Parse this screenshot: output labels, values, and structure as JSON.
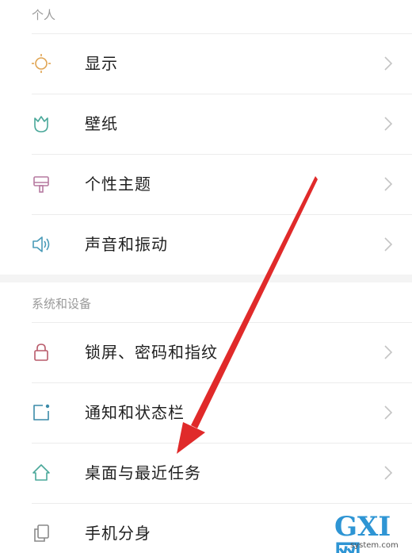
{
  "sections": {
    "personal": {
      "header": "个人",
      "items": [
        {
          "label": "显示",
          "icon": "sun-icon"
        },
        {
          "label": "壁纸",
          "icon": "flower-icon"
        },
        {
          "label": "个性主题",
          "icon": "brush-icon"
        },
        {
          "label": "声音和振动",
          "icon": "speaker-icon"
        }
      ]
    },
    "system": {
      "header": "系统和设备",
      "items": [
        {
          "label": "锁屏、密码和指纹",
          "icon": "lock-icon"
        },
        {
          "label": "通知和状态栏",
          "icon": "notification-icon"
        },
        {
          "label": "桌面与最近任务",
          "icon": "home-icon"
        },
        {
          "label": "手机分身",
          "icon": "dual-phone-icon"
        }
      ]
    }
  },
  "watermark": {
    "logo": "GXI网",
    "sub": "system.com"
  },
  "colors": {
    "sun": "#e0a452",
    "flower": "#4aa89a",
    "brush": "#b67aa0",
    "speaker": "#4a9bb8",
    "lock": "#b85a6a",
    "notification": "#3a8aa8",
    "home": "#4aa89a",
    "dual": "#888888",
    "arrow": "#e02a2a"
  }
}
